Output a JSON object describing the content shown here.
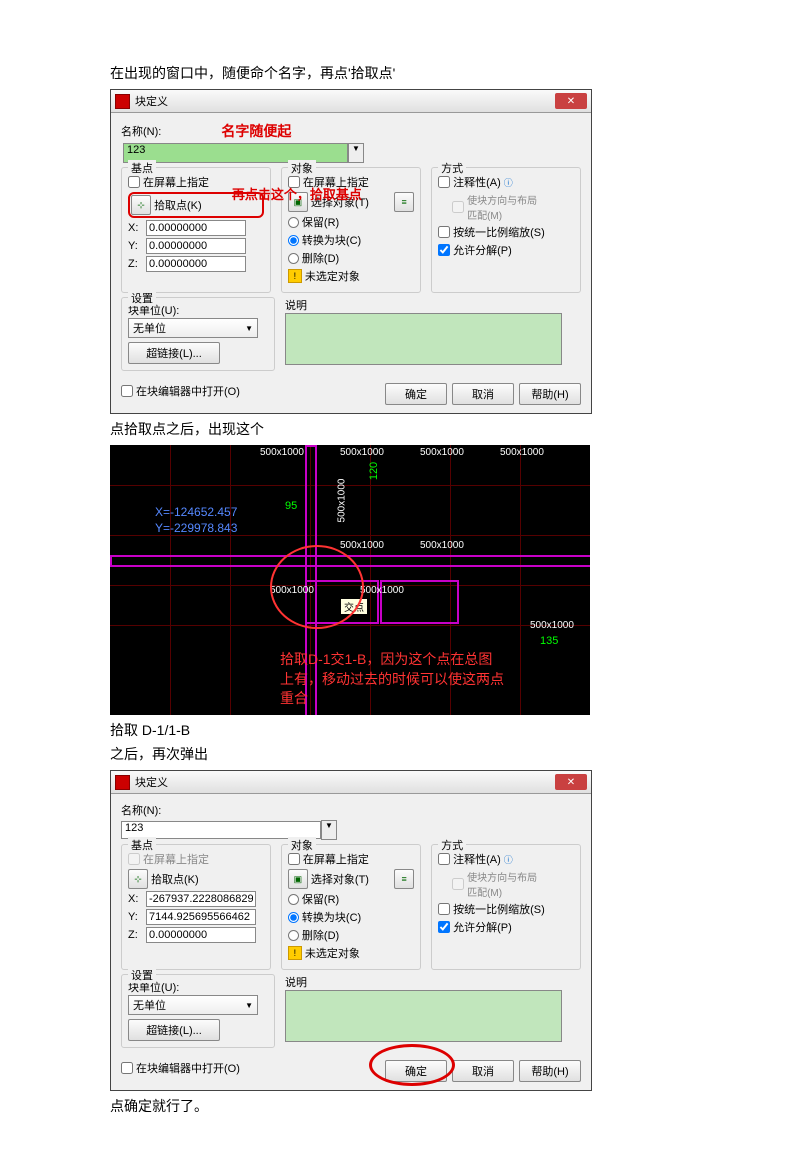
{
  "intro1": "在出现的窗口中，随便命个名字，再点'拾取点'",
  "dlg": {
    "title": "块定义",
    "name_lbl": "名称(N):",
    "name_val": "123",
    "anno_name": "名字随便起",
    "grp_base": "基点",
    "grp_obj": "对象",
    "grp_mode": "方式",
    "onscreen": "在屏幕上指定",
    "pickpoint": "拾取点(K)",
    "selobj": "选择对象(T)",
    "retain": "保留(R)",
    "toblock": "转换为块(C)",
    "delete": "删除(D)",
    "noobj": "未选定对象",
    "annotative": "注释性(A)",
    "orient": "使块方向与布局\n匹配(M)",
    "uniform": "按统一比例缩放(S)",
    "explode": "允许分解(P)",
    "x": "X:",
    "y": "Y:",
    "z": "Z:",
    "v0": "0.00000000",
    "vx2": "-267937.2228086829",
    "vy2": "7144.925695566462",
    "vz2": "0.00000000",
    "anno_mid": "再点击这个，拾取基点",
    "settings": "设置",
    "unit_lbl": "块单位(U):",
    "unit_val": "无单位",
    "hyper": "超链接(L)...",
    "desc_lbl": "说明",
    "openedit": "在块编辑器中打开(O)",
    "ok": "确定",
    "cancel": "取消",
    "help": "帮助(H)"
  },
  "mid1": "点拾取点之后，出现这个",
  "cad": {
    "coord_x": "X=-124652.457",
    "coord_y": "Y=-229978.843",
    "dim": "500x1000",
    "g95": "95",
    "g120": "120",
    "g135": "135",
    "tooltip": "交点",
    "redtext": "拾取D-1交1-B，因为这个点在总图\n上有，移动过去的时候可以使这两点\n重合"
  },
  "mid2a": "拾取 D-1/1-B",
  "mid2b": "之后，再次弹出",
  "end": "点确定就行了。"
}
